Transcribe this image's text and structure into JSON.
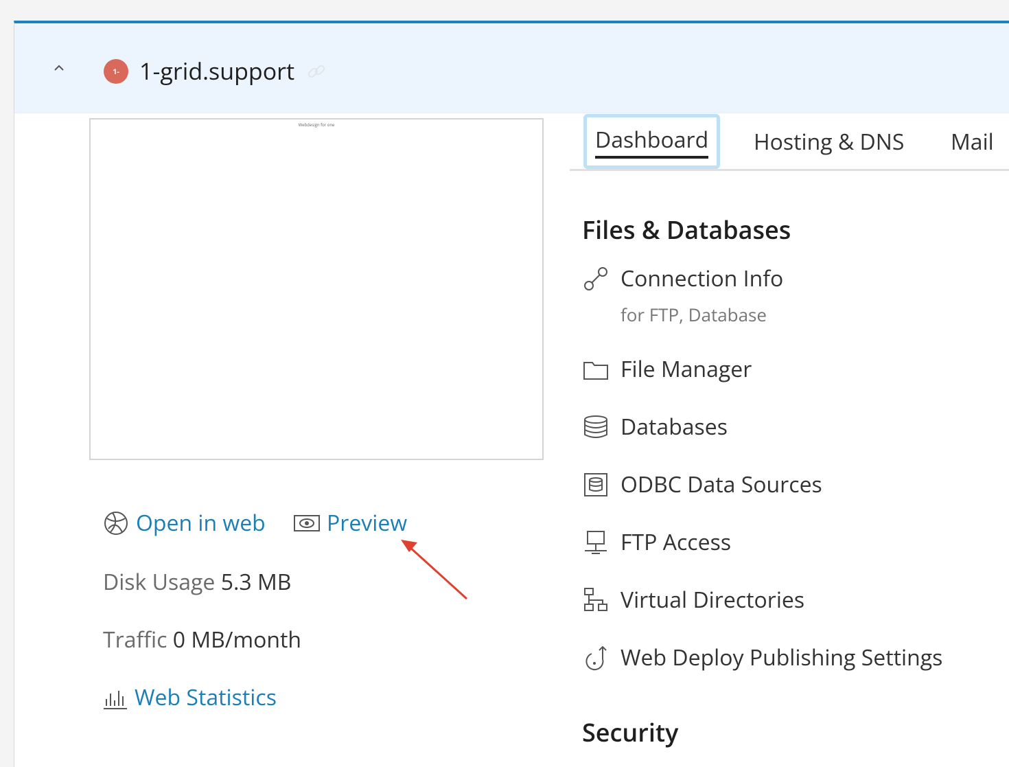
{
  "site": {
    "name": "1-grid.support",
    "avatar_text": "1-",
    "avatar_color": "#d9695a"
  },
  "preview": {
    "caption": "Webdesign for one"
  },
  "actions": {
    "open_in_web": "Open in web",
    "preview": "Preview",
    "web_statistics": "Web Statistics"
  },
  "stats": {
    "disk_label": "Disk Usage",
    "disk_value": "5.3 MB",
    "traffic_label": "Traffic",
    "traffic_value": "0 MB/month"
  },
  "tabs": [
    {
      "label": "Dashboard",
      "active": true
    },
    {
      "label": "Hosting & DNS",
      "active": false
    },
    {
      "label": "Mail",
      "active": false
    }
  ],
  "sections": {
    "files_title": "Files & Databases",
    "security_title": "Security"
  },
  "items": [
    {
      "label": "Connection Info",
      "sub": "for FTP, Database",
      "icon": "connection-icon"
    },
    {
      "label": "File Manager",
      "icon": "folder-icon"
    },
    {
      "label": "Databases",
      "icon": "database-icon"
    },
    {
      "label": "ODBC Data Sources",
      "icon": "odbc-icon"
    },
    {
      "label": "FTP Access",
      "icon": "ftp-icon"
    },
    {
      "label": "Virtual Directories",
      "icon": "virtual-directories-icon"
    },
    {
      "label": "Web Deploy Publishing Settings",
      "icon": "web-deploy-icon"
    }
  ],
  "colors": {
    "accent": "#1f82c0",
    "link": "#1b7fb6",
    "header_bg": "#ecf5fd",
    "annotation_arrow": "#e0402f"
  }
}
